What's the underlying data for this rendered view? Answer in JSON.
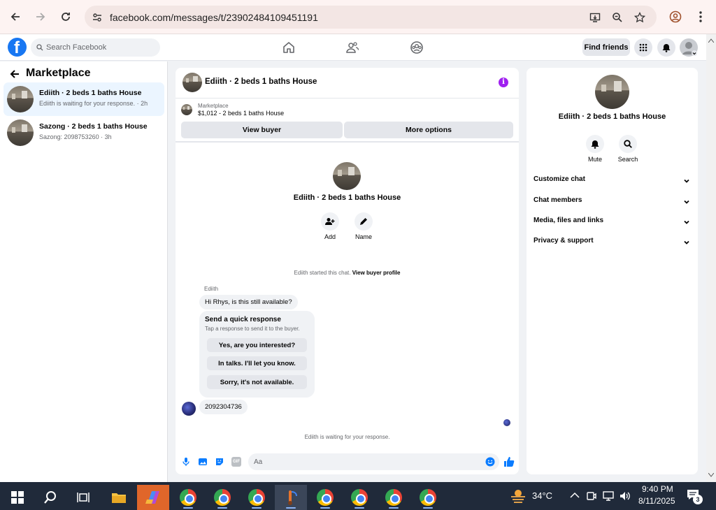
{
  "browser": {
    "url": "facebook.com/messages/t/23902484109451191"
  },
  "facebook": {
    "search_placeholder": "Search Facebook",
    "find_friends": "Find friends"
  },
  "sidebar": {
    "title": "Marketplace",
    "conversations": [
      {
        "name": "Ediith · 2 beds 1 baths House",
        "sub": "Ediith is waiting for your response. · 2h"
      },
      {
        "name": "Sazong · 2 beds 1 baths House",
        "sub": "Sazong: 2098753260 · 3h"
      }
    ]
  },
  "chat": {
    "title": "Ediith · 2 beds 1 baths House",
    "marketplace_label": "Marketplace",
    "listing": "$1,012 - 2 beds 1 baths House",
    "view_buyer": "View buyer",
    "more_options": "More options",
    "center_title": "Ediith · 2 beds 1 baths House",
    "add_label": "Add",
    "name_label": "Name",
    "started_text": "Ediith started this chat.",
    "view_buyer_profile": "View buyer profile",
    "sender": "Ediith",
    "message1": "Hi Rhys, is this still available?",
    "quick_title": "Send a quick response",
    "quick_sub": "Tap a response to send it to the buyer.",
    "quick_replies": [
      "Yes, are you interested?",
      "In talks. I'll let you know.",
      "Sorry, it's not available."
    ],
    "my_message": "2092304736",
    "waiting": "Ediith is waiting for your response.",
    "composer_placeholder": "Aa",
    "gif_label": "GIF"
  },
  "right_panel": {
    "title": "Ediith · 2 beds 1 baths House",
    "mute": "Mute",
    "search": "Search",
    "sections": [
      "Customize chat",
      "Chat members",
      "Media, files and links",
      "Privacy & support"
    ]
  },
  "taskbar": {
    "temperature": "34°C",
    "time": "9:40 PM",
    "date": "8/11/2025",
    "notifications": "3"
  },
  "colors": {
    "fb_blue": "#1877f2",
    "active_conv": "#ebf5ff",
    "info_purple": "#a020f0"
  }
}
